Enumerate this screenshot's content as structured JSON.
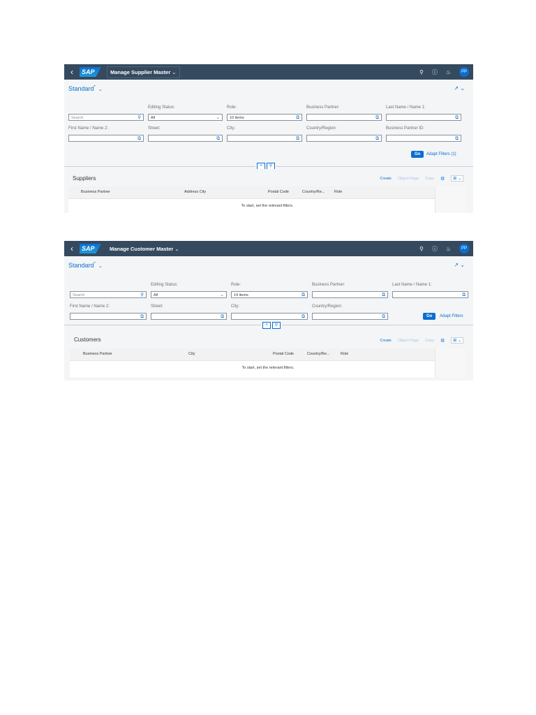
{
  "supplier": {
    "title": "Manage Supplier Master",
    "variant": "Standard",
    "variant_marker": "*",
    "avatar": "PP",
    "filters": {
      "search_placeholder": "Search",
      "editing_status_label": "Editing Status:",
      "editing_status_value": "All",
      "role_label": "Role:",
      "role_value": "10 items",
      "business_partner_label": "Business Partner:",
      "last_name_label": "Last Name / Name 1:",
      "first_name_label": "First Name / Name 2:",
      "street_label": "Street:",
      "city_label": "City:",
      "country_label": "Country/Region:",
      "bp_id_label": "Business Partner ID:"
    },
    "go": "Go",
    "adapt_filters": "Adapt Filters (1)",
    "section_title": "Suppliers",
    "toolbar": {
      "create": "Create",
      "object_page": "Object Page",
      "copy": "Copy"
    },
    "columns": [
      "Business Partner",
      "Address City",
      "Postal Code",
      "Country/Re...",
      "Role"
    ],
    "empty_text": "To start, set the relevant filters."
  },
  "customer": {
    "title": "Manage Customer Master",
    "variant": "Standard",
    "variant_marker": "*",
    "avatar": "PP",
    "filters": {
      "search_placeholder": "Search",
      "editing_status_label": "Editing Status:",
      "editing_status_value": "All",
      "role_label": "Role:",
      "role_value": "14 items",
      "business_partner_label": "Business Partner:",
      "last_name_label": "Last Name / Name 1:",
      "first_name_label": "First Name / Name 2:",
      "street_label": "Street:",
      "city_label": "City:",
      "country_label": "Country/Region:"
    },
    "go": "Go",
    "adapt_filters": "Adapt Filters",
    "section_title": "Customers",
    "toolbar": {
      "create": "Create",
      "object_page": "Object Page",
      "copy": "Copy"
    },
    "columns": [
      "Business Partner",
      "City",
      "Postal Code",
      "Country/Re...",
      "Role"
    ],
    "empty_text": "To start, set the relevant filters."
  },
  "colors": {
    "shell": "#354a5f",
    "accent": "#0a6ed1",
    "background": "#f4f5f6"
  }
}
